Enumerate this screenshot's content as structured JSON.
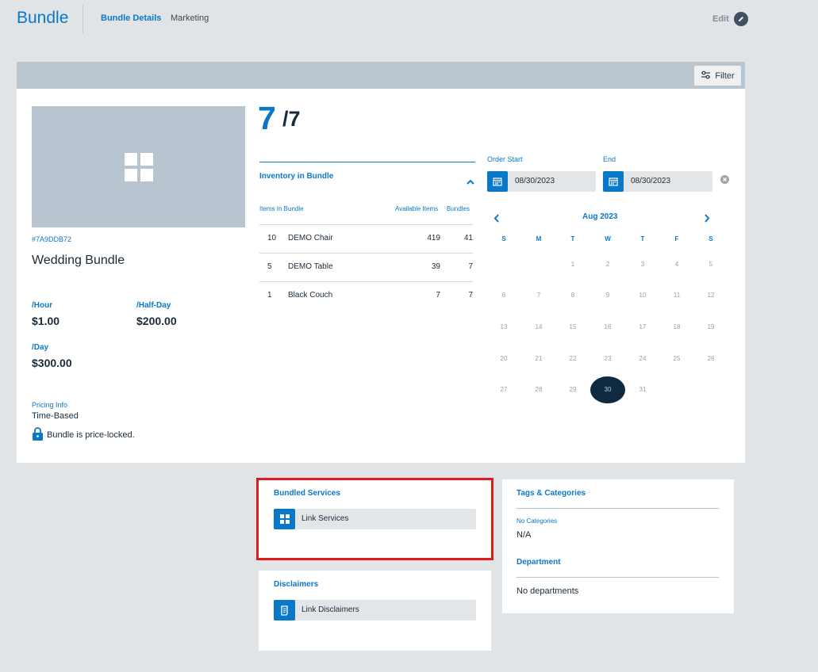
{
  "header": {
    "title": "Bundle",
    "tabs": [
      {
        "label": "Bundle Details",
        "active": true
      },
      {
        "label": "Marketing",
        "active": false
      }
    ],
    "edit_label": "Edit"
  },
  "toolbar": {
    "filter_label": "Filter"
  },
  "bundle": {
    "sku": "#7A9DDB72",
    "name": "Wedding Bundle",
    "prices": [
      {
        "label": "/Hour",
        "value": "$1.00"
      },
      {
        "label": "/Half-Day",
        "value": "$200.00"
      },
      {
        "label": "/Day",
        "value": "$300.00"
      }
    ],
    "pricing_info_label": "Pricing Info",
    "pricing_info_value": "Time-Based",
    "price_locked_text": "Bundle is price-locked."
  },
  "availability": {
    "available": "7",
    "total": "/7"
  },
  "inventory": {
    "title": "Inventory in Bundle",
    "columns": [
      "Items In Bundle",
      "Available Items",
      "Bundles"
    ],
    "rows": [
      {
        "qty": "10",
        "name": "DEMO Chair",
        "available": "419",
        "bundles": "41"
      },
      {
        "qty": "5",
        "name": "DEMO Table",
        "available": "39",
        "bundles": "7"
      },
      {
        "qty": "1",
        "name": "Black Couch",
        "available": "7",
        "bundles": "7"
      }
    ]
  },
  "order": {
    "start_label": "Order Start",
    "start_value": "08/30/2023",
    "end_label": "End",
    "end_value": "08/30/2023"
  },
  "calendar": {
    "month": "Aug 2023",
    "weekdays": [
      "S",
      "M",
      "T",
      "W",
      "T",
      "F",
      "S"
    ],
    "weeks": [
      [
        "",
        "",
        "1",
        "2",
        "3",
        "4",
        "5"
      ],
      [
        "6",
        "7",
        "8",
        "9",
        "10",
        "11",
        "12"
      ],
      [
        "13",
        "14",
        "15",
        "16",
        "17",
        "18",
        "19"
      ],
      [
        "20",
        "21",
        "22",
        "23",
        "24",
        "25",
        "26"
      ],
      [
        "27",
        "28",
        "29",
        "30",
        "31",
        "",
        ""
      ]
    ],
    "selected": "30"
  },
  "services": {
    "title": "Bundled Services",
    "link_label": "Link Services"
  },
  "disclaimers": {
    "title": "Disclaimers",
    "link_label": "Link Disclaimers"
  },
  "tags": {
    "title": "Tags & Categories",
    "categories_label": "No Categories",
    "categories_value": "N/A",
    "department_title": "Department",
    "department_value": "No departments"
  },
  "colors": {
    "accent": "#0a78c8",
    "dark": "#0f2a40",
    "highlight": "#e01919"
  }
}
